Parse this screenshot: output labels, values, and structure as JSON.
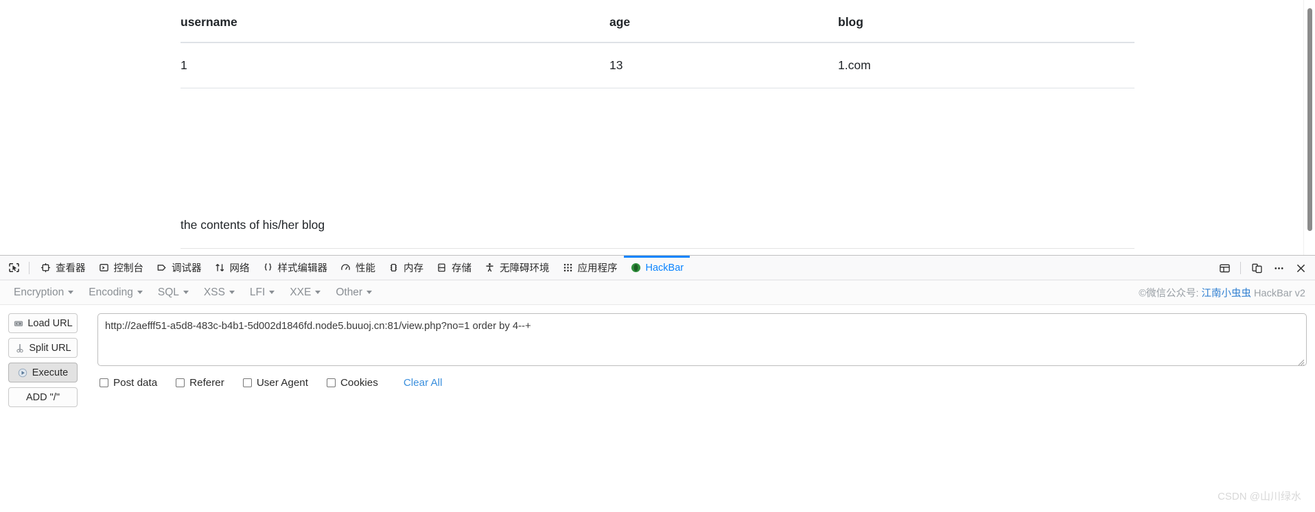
{
  "page": {
    "table": {
      "headers": [
        "username",
        "age",
        "blog"
      ],
      "rows": [
        [
          "1",
          "13",
          "1.com"
        ]
      ]
    },
    "blog_caption": "the contents of his/her blog"
  },
  "devtools": {
    "picker_icon": "element-picker-icon",
    "tabs": [
      {
        "label": "查看器",
        "icon": "inspector-icon",
        "active": false
      },
      {
        "label": "控制台",
        "icon": "console-icon",
        "active": false
      },
      {
        "label": "调试器",
        "icon": "debugger-icon",
        "active": false
      },
      {
        "label": "网络",
        "icon": "network-icon",
        "active": false
      },
      {
        "label": "样式编辑器",
        "icon": "style-editor-icon",
        "active": false
      },
      {
        "label": "性能",
        "icon": "performance-icon",
        "active": false
      },
      {
        "label": "内存",
        "icon": "memory-icon",
        "active": false
      },
      {
        "label": "存储",
        "icon": "storage-icon",
        "active": false
      },
      {
        "label": "无障碍环境",
        "icon": "accessibility-icon",
        "active": false
      },
      {
        "label": "应用程序",
        "icon": "application-icon",
        "active": false
      },
      {
        "label": "HackBar",
        "icon": "hackbar-icon",
        "active": true
      }
    ],
    "right_buttons": [
      {
        "name": "dock-layout-icon"
      },
      {
        "name": "responsive-design-mode-icon"
      },
      {
        "name": "more-options-icon"
      },
      {
        "name": "close-devtools-icon"
      }
    ],
    "accent_color": "#0a84ff"
  },
  "hackbar": {
    "menu": [
      "Encryption",
      "Encoding",
      "SQL",
      "XSS",
      "LFI",
      "XXE",
      "Other"
    ],
    "credit_prefix": "©微信公众号: ",
    "credit_link": "江南小虫虫",
    "credit_suffix": " HackBar v2",
    "buttons": [
      {
        "label": "Load URL",
        "icon": "load-url-icon",
        "pressed": false
      },
      {
        "label": "Split URL",
        "icon": "split-url-icon",
        "pressed": false
      },
      {
        "label": "Execute",
        "icon": "execute-icon",
        "pressed": true
      },
      {
        "label": "ADD \"/\"",
        "icon": "",
        "pressed": false
      }
    ],
    "url_value": "http://2aefff51-a5d8-483c-b4b1-5d002d1846fd.node5.buuoj.cn:81/view.php?no=1 order by 4--+",
    "url_placeholder": "",
    "checkboxes": [
      "Post data",
      "Referer",
      "User Agent",
      "Cookies"
    ],
    "clear_all": "Clear All"
  },
  "watermark": "CSDN @山川绿水"
}
